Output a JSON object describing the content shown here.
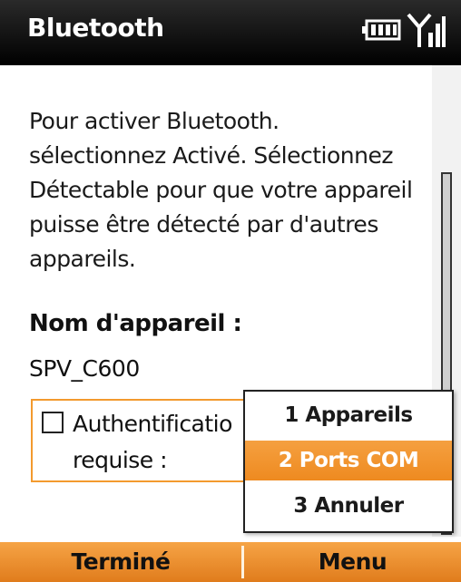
{
  "header": {
    "title": "Bluetooth",
    "icons": [
      "battery-icon",
      "signal-icon"
    ]
  },
  "content": {
    "description": "Pour activer Bluetooth.\nsélectionnez Activé. Sélectionnez\nDétectable pour que votre appareil\npuisse être détecté par d'autres\nappareils.",
    "device_name_label": "Nom d'appareil :",
    "device_name_value": "SPV_C600",
    "auth_label": "Authentificatio\nrequise :",
    "auth_checked": false
  },
  "menu": {
    "items": [
      {
        "label": "1 Appareils",
        "selected": false
      },
      {
        "label": "2 Ports COM",
        "selected": true
      },
      {
        "label": "3 Annuler",
        "selected": false
      }
    ]
  },
  "softkeys": {
    "left": "Terminé",
    "right": "Menu"
  },
  "colors": {
    "accent": "#f39a2e",
    "titlebar": "#000000"
  }
}
